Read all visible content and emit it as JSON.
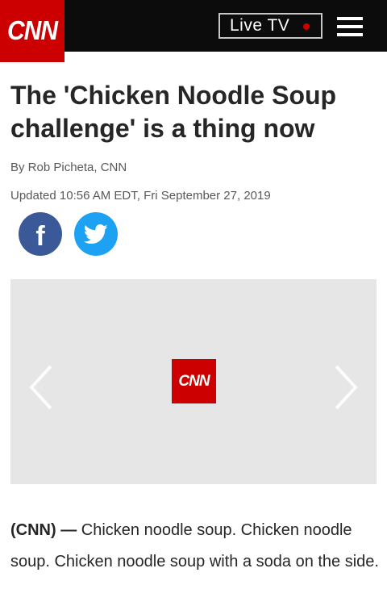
{
  "header": {
    "logo_text": "CNN",
    "live_tv_label": "Live TV",
    "menu_icon": "hamburger-menu-icon"
  },
  "article": {
    "headline": "The 'Chicken Noodle Soup challenge' is a thing now",
    "byline": "By Rob Picheta, CNN",
    "updated": "Updated 10:56 AM EDT, Fri September 27, 2019",
    "lede_source": "(CNN) —",
    "lede_text": " Chicken noodle soup. Chicken noodle soup. Chicken noodle soup with a soda on the side."
  },
  "share": {
    "facebook_letter": "f",
    "facebook_icon": "facebook-icon",
    "twitter_icon": "twitter-icon"
  },
  "gallery": {
    "logo_text": "CNN",
    "prev_icon": "chevron-left-icon",
    "next_icon": "chevron-right-icon"
  },
  "colors": {
    "brand_red": "#cc0000",
    "header_bg": "#0c0c0c",
    "facebook_blue": "#3b5998",
    "twitter_blue": "#1da1f2",
    "gallery_bg": "#e6e6e6"
  }
}
